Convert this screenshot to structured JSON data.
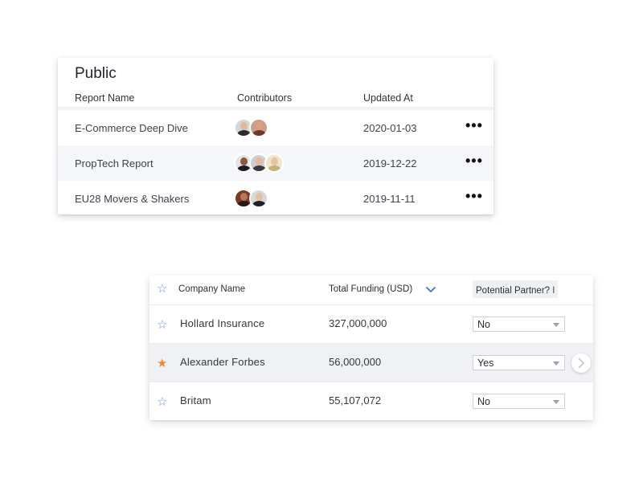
{
  "public_card": {
    "title": "Public",
    "columns": {
      "report_name": "Report Name",
      "contributors": "Contributors",
      "updated_at": "Updated At"
    },
    "rows": [
      {
        "name": "E-Commerce Deep Dive",
        "date": "2020-01-03",
        "more": "•••"
      },
      {
        "name": "PropTech Report",
        "date": "2019-12-22",
        "more": "•••"
      },
      {
        "name": "EU28 Movers & Shakers",
        "date": "2019-11-11",
        "more": "•••"
      }
    ]
  },
  "company_card": {
    "columns": {
      "star": "☆",
      "company_name": "Company Name",
      "total_funding": "Total Funding (USD)",
      "potential_partner": "Potential Partner?"
    },
    "rows": [
      {
        "starred": "☆",
        "name": "Hollard Insurance",
        "funding": "327,000,000",
        "partner": "No"
      },
      {
        "starred": "★",
        "name": "Alexander Forbes",
        "funding": "56,000,000",
        "partner": "Yes"
      },
      {
        "starred": "☆",
        "name": "Britam",
        "funding": "55,107,072",
        "partner": "No"
      }
    ]
  },
  "colors": {
    "star_outline": "#6b8fd8",
    "star_filled": "#f0883b",
    "sort_icon": "#3a73d8"
  }
}
